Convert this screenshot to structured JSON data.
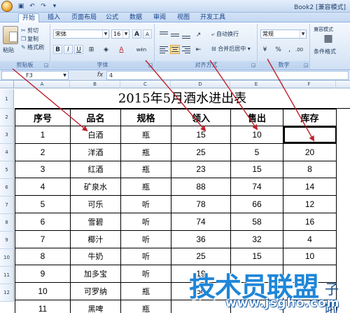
{
  "window": {
    "title": "Book2 [兼容模式]"
  },
  "tabs": [
    "开始",
    "插入",
    "页面布局",
    "公式",
    "数据",
    "审阅",
    "视图",
    "开发工具"
  ],
  "ribbon": {
    "clipboard": {
      "paste": "粘贴",
      "cut": "剪切",
      "copy": "复制",
      "format_painter": "格式刷",
      "label": "剪贴板"
    },
    "font": {
      "name": "宋体",
      "size": "16",
      "bold": "B",
      "italic": "I",
      "underline": "U",
      "grow": "A",
      "shrink": "A",
      "font_color_letter": "A",
      "phonetic": "wén",
      "label": "字体"
    },
    "alignment": {
      "wrap_text": "自动换行",
      "merge_center": "合并后居中",
      "label": "对齐方式"
    },
    "number": {
      "format": "常规",
      "percent": "%",
      "comma": ",",
      "label": "数字"
    },
    "styles": {
      "conditional": "条件格式",
      "cond_small": "兼容模式"
    }
  },
  "formula_bar": {
    "cell_ref": "F3",
    "fx": "fx",
    "value": "4"
  },
  "columns": [
    "A",
    "B",
    "C",
    "D",
    "E",
    "F"
  ],
  "rows": [
    "1",
    "2",
    "3",
    "4",
    "5",
    "6",
    "7",
    "8",
    "9",
    "10",
    "11",
    "12"
  ],
  "sheet": {
    "title": "2015年5月酒水进出表",
    "headers": [
      "序号",
      "品名",
      "规格",
      "领入",
      "售出",
      "库存"
    ],
    "data": [
      [
        "1",
        "白酒",
        "瓶",
        "15",
        "10",
        ""
      ],
      [
        "2",
        "洋酒",
        "瓶",
        "25",
        "5",
        "20"
      ],
      [
        "3",
        "红酒",
        "瓶",
        "23",
        "15",
        "8"
      ],
      [
        "4",
        "矿泉水",
        "瓶",
        "88",
        "74",
        "14"
      ],
      [
        "5",
        "可乐",
        "听",
        "78",
        "66",
        "12"
      ],
      [
        "6",
        "雪碧",
        "听",
        "74",
        "58",
        "16"
      ],
      [
        "7",
        "椰汁",
        "听",
        "36",
        "32",
        "4"
      ],
      [
        "8",
        "牛奶",
        "听",
        "25",
        "15",
        "10"
      ],
      [
        "9",
        "加多宝",
        "听",
        "19",
        "",
        ""
      ],
      [
        "10",
        "可罗纳",
        "瓶",
        "50",
        "",
        ""
      ],
      [
        "11",
        "黑啤",
        "瓶",
        "",
        "",
        ""
      ]
    ]
  },
  "watermark": {
    "main": "技术员联盟",
    "sub": "子啦",
    "url": "www.jsgho.com"
  },
  "colors": {
    "accent": "#c0202a",
    "ribbon_border": "#8db2e3"
  }
}
